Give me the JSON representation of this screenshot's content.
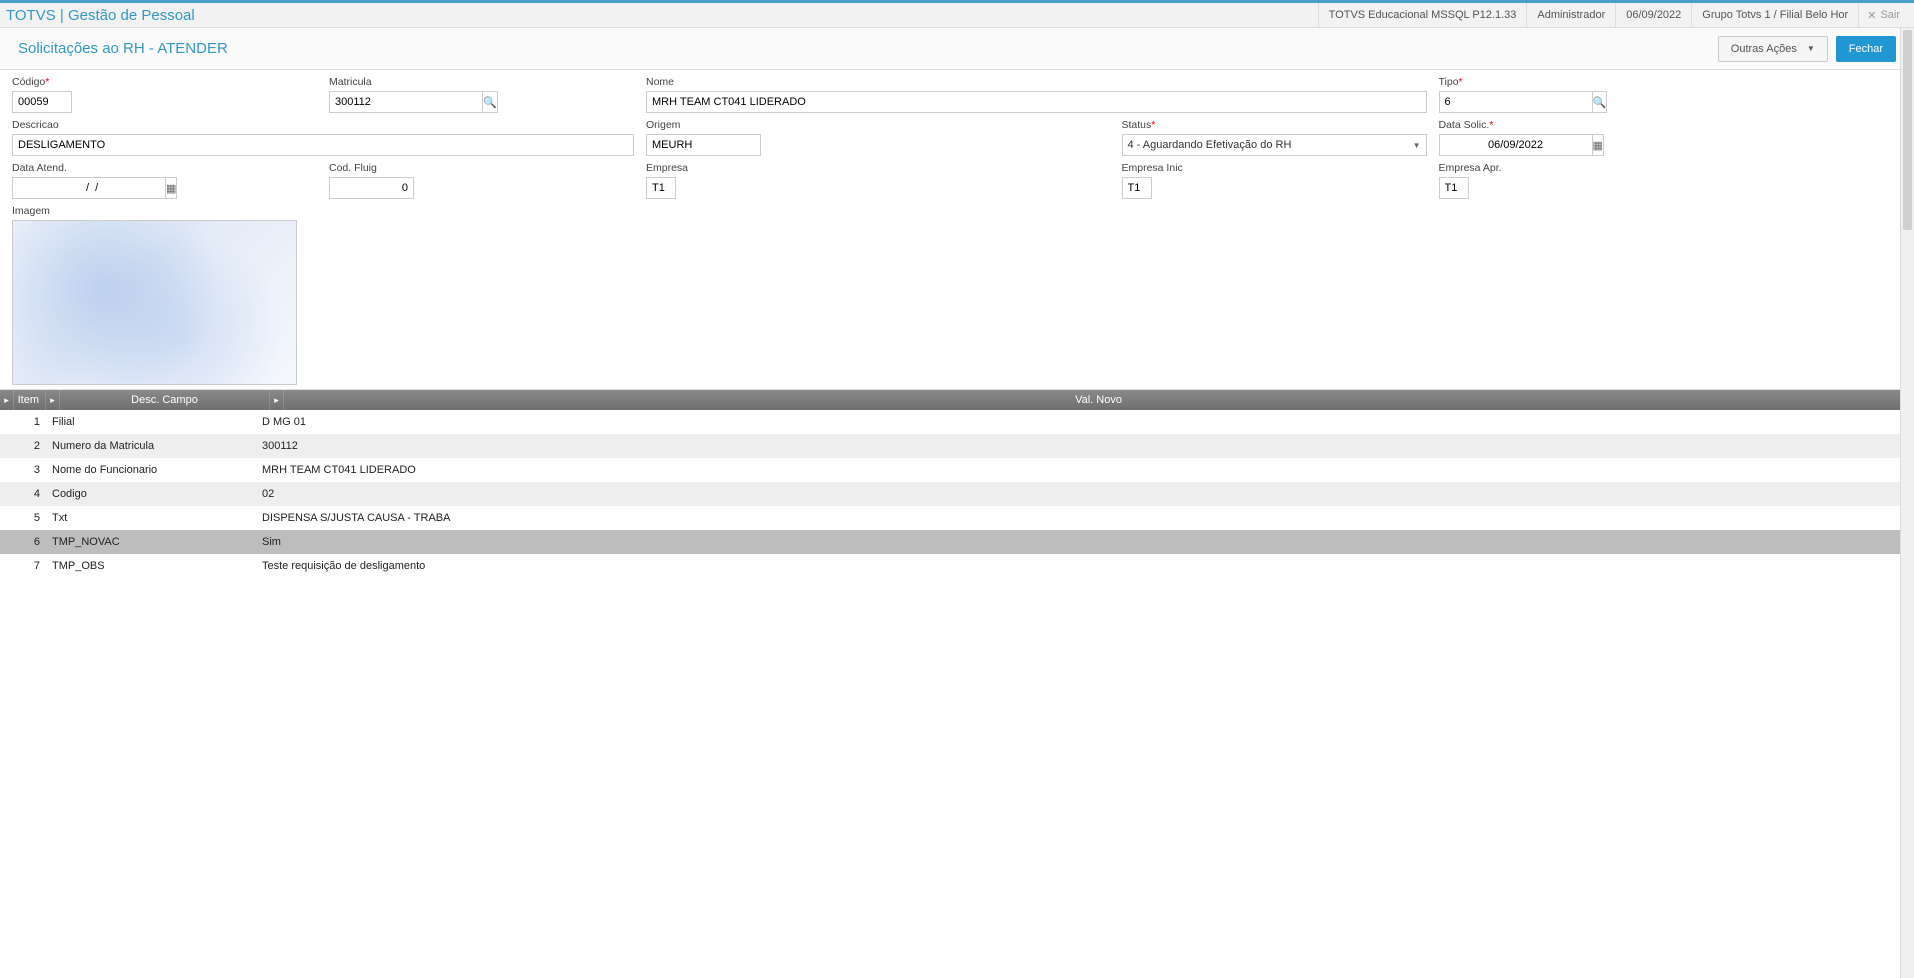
{
  "topbar": {
    "app_title": "TOTVS | Gestão de Pessoal",
    "env": "TOTVS Educacional MSSQL P12.1.33",
    "user": "Administrador",
    "date": "06/09/2022",
    "branch": "Grupo Totvs 1 / Filial Belo Hor",
    "exit_label": "Sair"
  },
  "subheader": {
    "title": "Solicitações ao RH - ATENDER",
    "other_actions_label": "Outras Ações",
    "close_label": "Fechar"
  },
  "form": {
    "codigo": {
      "label": "Código",
      "value": "00059"
    },
    "matricula": {
      "label": "Matricula",
      "value": "300112"
    },
    "nome": {
      "label": "Nome",
      "value": "MRH TEAM CT041 LIDERADO"
    },
    "tipo": {
      "label": "Tipo",
      "value": "6"
    },
    "descricao": {
      "label": "Descricao",
      "value": "DESLIGAMENTO"
    },
    "origem": {
      "label": "Origem",
      "value": "MEURH"
    },
    "status": {
      "label": "Status",
      "value": "4 - Aguardando Efetivação do RH"
    },
    "data_solic": {
      "label": "Data Solic.",
      "value": "06/09/2022"
    },
    "data_atend": {
      "label": "Data Atend.",
      "value": "  /  /"
    },
    "cod_fluig": {
      "label": "Cod. Fluig",
      "value": "0"
    },
    "empresa": {
      "label": "Empresa",
      "value": "T1"
    },
    "empresa_inic": {
      "label": "Empresa Inic",
      "value": "T1"
    },
    "empresa_apr": {
      "label": "Empresa Apr.",
      "value": "T1"
    },
    "imagem": {
      "label": "Imagem"
    }
  },
  "grid": {
    "headers": {
      "item": "Item",
      "campo": "Desc. Campo",
      "novo": "Val. Novo"
    },
    "rows": [
      {
        "item": "1",
        "campo": "Filial",
        "novo": "D MG 01"
      },
      {
        "item": "2",
        "campo": "Numero da Matricula",
        "novo": "300112"
      },
      {
        "item": "3",
        "campo": "Nome do Funcionario",
        "novo": "MRH TEAM CT041 LIDERADO"
      },
      {
        "item": "4",
        "campo": "Codigo",
        "novo": "02"
      },
      {
        "item": "5",
        "campo": "Txt",
        "novo": "DISPENSA S/JUSTA CAUSA - TRABA"
      },
      {
        "item": "6",
        "campo": "TMP_NOVAC",
        "novo": "Sim"
      },
      {
        "item": "7",
        "campo": "TMP_OBS",
        "novo": "Teste requisição de desligamento"
      }
    ],
    "selected_index": 5
  }
}
